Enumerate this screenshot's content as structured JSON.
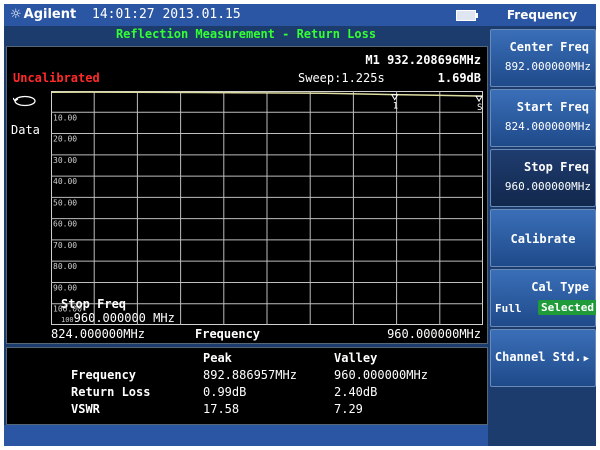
{
  "header": {
    "brand": "Agilent",
    "datetime": "14:01:27 2013.01.15"
  },
  "measurement_title": "Reflection Measurement - Return Loss",
  "status": {
    "calibration": "Uncalibrated",
    "marker_readout": "M1 932.208696MHz",
    "sweep": "Sweep:1.225s",
    "marker_value": "1.69dB",
    "data_label": "Data"
  },
  "chart_data": {
    "type": "line",
    "x_start_label": "824.000000MHz",
    "x_end_label": "960.000000MHz",
    "xlabel": "Frequency",
    "xlim": [
      824.0,
      960.0
    ],
    "ylim": [
      0,
      110
    ],
    "y_ticks": [
      "10.00",
      "20.00",
      "30.00",
      "40.00",
      "50.00",
      "60.00",
      "70.00",
      "80.00",
      "90.00",
      "100.00"
    ],
    "grid": true,
    "series": [
      {
        "x": [
          824.0,
          835.0,
          850.0,
          870.0,
          890.0,
          910.0,
          932.2,
          945.0,
          960.0
        ],
        "values": [
          0.6,
          0.5,
          0.6,
          0.7,
          0.9,
          1.1,
          1.7,
          2.0,
          2.4
        ],
        "color": "#dcdca0"
      }
    ],
    "markers": [
      {
        "label": "1",
        "x": 932.2,
        "y": 1.69
      },
      {
        "label": "S",
        "x": 960.0,
        "y": 2.4
      }
    ]
  },
  "stop_freq_box": {
    "title": "Stop Freq",
    "prefix": "100",
    "value": "960.000000 MHz"
  },
  "results": {
    "headers": [
      "Peak",
      "Valley"
    ],
    "rows": [
      {
        "label": "Frequency",
        "peak": "892.886957MHz",
        "valley": "960.000000MHz"
      },
      {
        "label": "Return Loss",
        "peak": "0.99dB",
        "valley": "2.40dB"
      },
      {
        "label": "VSWR",
        "peak": "17.58",
        "valley": "7.29"
      }
    ]
  },
  "menu": {
    "title": "Frequency",
    "center_freq": {
      "label": "Center Freq",
      "value": "892.000000MHz"
    },
    "start_freq": {
      "label": "Start Freq",
      "value": "824.000000MHz"
    },
    "stop_freq": {
      "label": "Stop Freq",
      "value": "960.000000MHz"
    },
    "calibrate": {
      "label": "Calibrate"
    },
    "cal_type": {
      "label": "Cal Type",
      "option1": "Full",
      "option2": "Selected"
    },
    "channel_std": {
      "label": "Channel Std."
    }
  },
  "colors": {
    "title_green": "#33ff33",
    "uncal_red": "#ff2a2a",
    "trace": "#dcdca0",
    "selected_green": "#1f9b3a"
  }
}
